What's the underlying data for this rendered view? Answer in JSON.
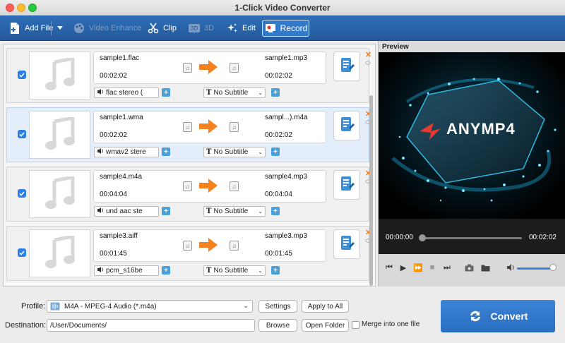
{
  "window": {
    "title": "1-Click Video Converter"
  },
  "toolbar": {
    "add_file": "Add File",
    "video_enhance": "Video Enhance",
    "clip": "Clip",
    "three_d": "3D",
    "edit": "Edit",
    "record": "Record"
  },
  "rows": [
    {
      "src_name": "sample1.flac",
      "src_time": "00:02:02",
      "dst_name": "sample1.mp3",
      "dst_time": "00:02:02",
      "audio": "flac stereo (",
      "subtitle": "No Subtitle",
      "checked": true,
      "selected": false
    },
    {
      "src_name": "sample1.wma",
      "src_time": "00:02:02",
      "dst_name": "sampl...).m4a",
      "dst_time": "00:02:02",
      "audio": "wmav2 stere",
      "subtitle": "No Subtitle",
      "checked": true,
      "selected": true
    },
    {
      "src_name": "sample4.m4a",
      "src_time": "00:04:04",
      "dst_name": "sample4.mp3",
      "dst_time": "00:04:04",
      "audio": "und aac ste",
      "subtitle": "No Subtitle",
      "checked": true,
      "selected": false
    },
    {
      "src_name": "sample3.aiff",
      "src_time": "00:01:45",
      "dst_name": "sample3.mp3",
      "dst_time": "00:01:45",
      "audio": "pcm_s16be",
      "subtitle": "No Subtitle",
      "checked": true,
      "selected": false
    }
  ],
  "preview": {
    "label": "Preview",
    "logo_text": "ANYMP4",
    "time_current": "00:00:00",
    "time_total": "00:02:02",
    "progress": 0.0,
    "volume": 1.0
  },
  "bottom": {
    "profile_label": "Profile:",
    "profile_value": "M4A - MPEG-4 Audio (*.m4a)",
    "settings": "Settings",
    "apply_to_all": "Apply to All",
    "destination_label": "Destination:",
    "destination_value": "/User/Documents/",
    "browse": "Browse",
    "open_folder": "Open Folder",
    "merge_label": "Merge into one file",
    "merge_checked": false,
    "convert": "Convert"
  },
  "colors": {
    "toolbar": "#2a63aa",
    "accent": "#2a7fe8",
    "arrow": "#f5821f",
    "convert": "#3178c9"
  }
}
